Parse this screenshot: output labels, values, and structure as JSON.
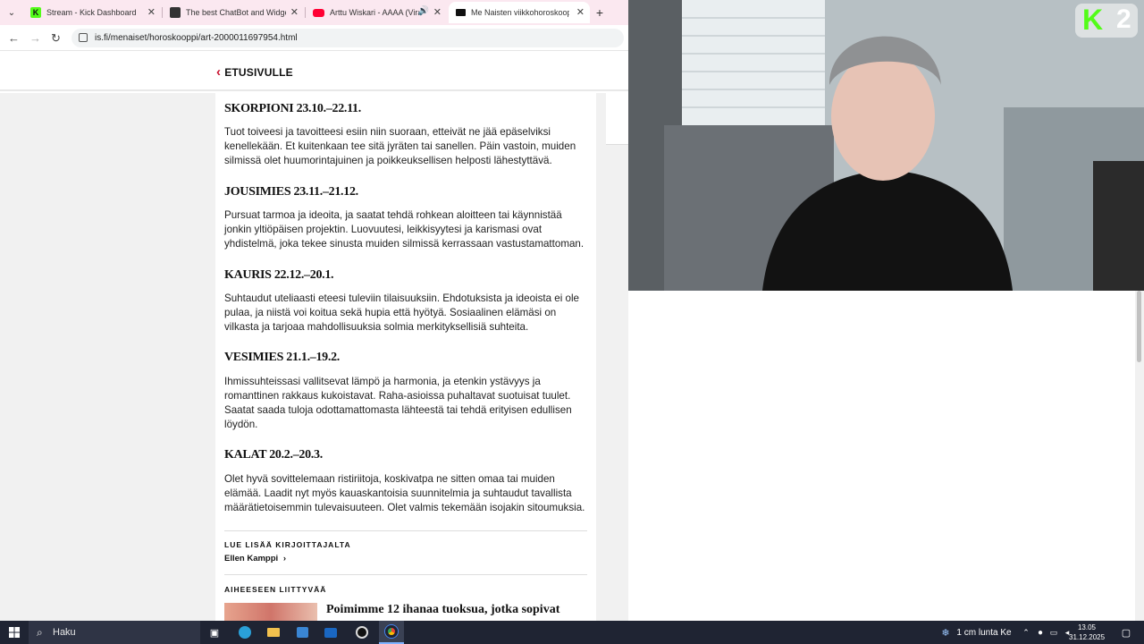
{
  "browser": {
    "tabs": [
      {
        "title": "Stream - Kick Dashboard",
        "icon": "kick-icon",
        "color": "#53fc18"
      },
      {
        "title": "The best ChatBot and Widgets",
        "icon": "botrix-icon",
        "color": "#333333"
      },
      {
        "title": "Arttu Wiskari - AAAA (Viral",
        "icon": "youtube-icon",
        "color": "#ff0033"
      },
      {
        "title": "Me Naisten viikkohoroskoopp",
        "icon": "menaiset-icon",
        "color": "#111111"
      }
    ],
    "url": "is.fi/menaiset/horoskooppi/art-2000011697954.html"
  },
  "page": {
    "back_label": "ETUSIVULLE",
    "signs": [
      {
        "name": "SKORPIONI 23.10.–22.11.",
        "text": "Tuot toiveesi ja tavoitteesi esiin niin suoraan, etteivät ne jää epäselviksi kenellekään. Et kuitenkaan tee sitä jyräten tai sanellen. Päin vastoin, muiden silmissä olet huumorintajuinen ja poikkeuksellisen helposti lähestyttävä."
      },
      {
        "name": "JOUSIMIES 23.11.–21.12.",
        "text": "Pursuat tarmoa ja ideoita, ja saatat tehdä rohkean aloitteen tai käynnistää jonkin yltiöpäisen projektin. Luovuutesi, leikkisyytesi ja karismasi ovat yhdistelmä, joka tekee sinusta muiden silmissä kerrassaan vastustamattoman."
      },
      {
        "name": "KAURIS 22.12.–20.1.",
        "text": "Suhtaudut uteliaasti eteesi tuleviin tilaisuuksiin. Ehdotuksista ja ideoista ei ole pulaa, ja niistä voi koitua sekä hupia että hyötyä. Sosiaalinen elämäsi on vilkasta ja tarjoaa mahdollisuuksia solmia merkityksellisiä suhteita."
      },
      {
        "name": "VESIMIES 21.1.–19.2.",
        "text": "Ihmissuhteissasi vallitsevat lämpö ja harmonia, ja etenkin ystävyys ja romanttinen rakkaus kukoistavat. Raha-asioissa puhaltavat suotuisat tuulet. Saatat saada tuloja odottamattomasta lähteestä tai tehdä erityisen edullisen löydön."
      },
      {
        "name": "KALAT 20.2.–20.3.",
        "text": "Olet hyvä sovittelemaan ristiriitoja, koskivatpa ne sitten omaa tai muiden elämää. Laadit nyt myös kauaskantoisia suunnitelmia ja suhtaudut tavallista määrätietoisemmin tulevaisuuteen. Olet valmis tekemään isojakin sitoumuksia."
      }
    ],
    "read_more_label": "LUE LISÄÄ KIRJOITTAJALTA",
    "author": "Ellen Kamppi",
    "related_label": "AIHEESEEN LIITTYVÄÄ",
    "related_title": "Poimimme 12 ihanaa tuoksua, jotka sopivat"
  },
  "stream_overlay": {
    "logo_letter": "K",
    "number": "2",
    "logo_color": "#53fc18"
  },
  "taskbar": {
    "search_label": "Haku",
    "weather": "1 cm lunta Ke",
    "time": "13.05",
    "date": "31.12.2025"
  }
}
